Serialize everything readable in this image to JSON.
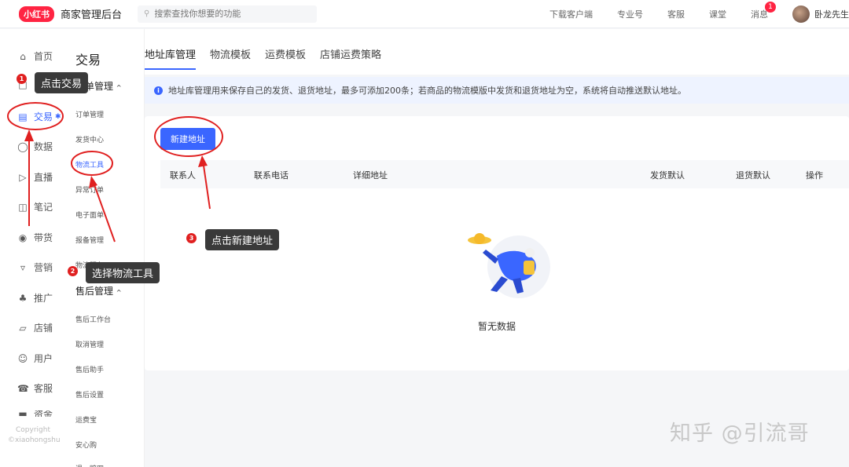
{
  "topbar": {
    "logo": "小红书",
    "title": "商家管理后台",
    "search_placeholder": "搜索查找你想要的功能",
    "nav": [
      "下载客户端",
      "专业号",
      "客服",
      "课堂",
      "消息"
    ],
    "message_badge": "1",
    "username": "卧龙先生"
  },
  "sidebar": {
    "items": [
      {
        "label": "首页",
        "icon": "home-icon"
      },
      {
        "label": "",
        "icon": "cart-icon"
      },
      {
        "label": "交易",
        "icon": "trade-icon"
      },
      {
        "label": "数据",
        "icon": "chart-icon"
      },
      {
        "label": "直播",
        "icon": "live-icon"
      },
      {
        "label": "笔记",
        "icon": "book-icon"
      },
      {
        "label": "带货",
        "icon": "bag-icon"
      },
      {
        "label": "营销",
        "icon": "megaphone-icon"
      },
      {
        "label": "推广",
        "icon": "promote-icon"
      },
      {
        "label": "店铺",
        "icon": "shop-icon"
      },
      {
        "label": "用户",
        "icon": "users-icon"
      },
      {
        "label": "客服",
        "icon": "service-icon"
      },
      {
        "label": "资金",
        "icon": "wallet-icon"
      }
    ],
    "copyright": "Copyright",
    "copyright_sub": "©xiaohongshu"
  },
  "subsidebar": {
    "title": "交易",
    "group1": "订单管理",
    "group1_items": [
      "订单管理",
      "发货中心",
      "物流工具",
      "异常订单",
      "电子面单",
      "报备管理",
      "物流服务"
    ],
    "group2": "售后管理",
    "group2_items": [
      "售后工作台",
      "取消管理",
      "售后助手",
      "售后设置",
      "运费宝",
      "安心购",
      "退一赔四"
    ]
  },
  "tabs": [
    "地址库管理",
    "物流模板",
    "运费模板",
    "店铺运费策略"
  ],
  "notice": "地址库管理用来保存自己的发货、退货地址，最多可添加200条；若商品的物流模版中发货和退货地址为空，系统将自动推送默认地址。",
  "card": {
    "new_button": "新建地址",
    "columns": [
      "联系人",
      "联系电话",
      "详细地址",
      "发货默认",
      "退货默认",
      "操作"
    ],
    "empty_text": "暂无数据"
  },
  "annotations": {
    "step1_num": "1",
    "step1": "点击交易",
    "step2_num": "2",
    "step2": "选择物流工具",
    "step3_num": "3",
    "step3": "点击新建地址"
  },
  "watermark": "知乎 @引流哥",
  "colors": {
    "accent": "#3a66ff",
    "brand": "#ff2442",
    "annotation": "#e02020"
  }
}
